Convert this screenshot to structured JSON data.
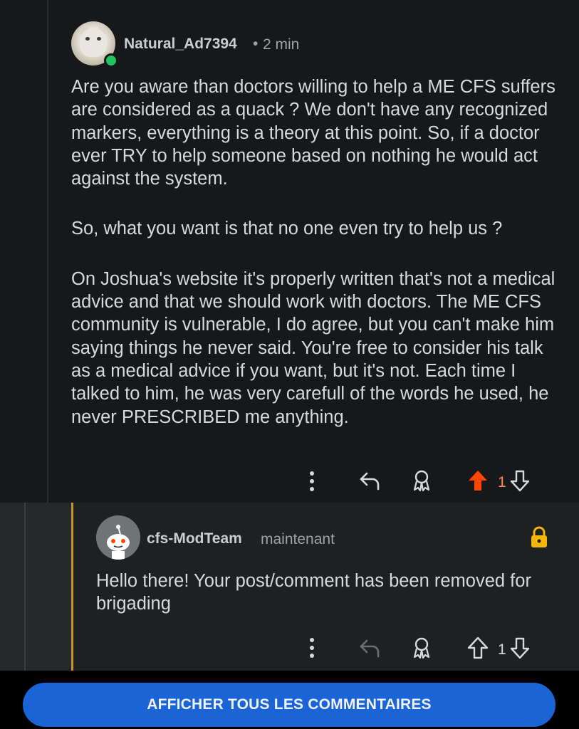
{
  "comment1": {
    "author": "Natural_Ad7394",
    "separator": "•",
    "time": "2 min",
    "paragraphs": [
      "Are you aware than doctors willing to help a ME CFS suffers are considered as a quack ? We don't have any recognized markers, everything is a theory at this point. So, if a doctor ever TRY to help someone based on nothing he would act against the system.",
      "So, what you want is that no one even try to help us ?",
      "On Joshua's website it's properly written that's not a medical advice and that we should work with doctors. The ME CFS community is vulnerable, I do agree, but you can't make him saying things he never said. You're free to consider his talk as a medical advice if you want, but it's not. Each time I talked to him, he was very carefull of the words he used, he never PRESCRIBED me anything."
    ],
    "votes": "1",
    "upvote_color": "#ff4500",
    "online_color": "#21c55d"
  },
  "comment2": {
    "author": "cfs-ModTeam",
    "time": "maintenant",
    "text": "Hello there! Your post/comment has been removed for brigading",
    "votes": "1",
    "lock_color": "#f5b50a",
    "stripe_color": "#c8941a"
  },
  "footer": {
    "button_label": "AFFICHER TOUS LES COMMENTAIRES",
    "button_color": "#1a64d6"
  },
  "icons": [
    "more-icon",
    "reply-icon",
    "award-icon",
    "upvote-icon",
    "downvote-icon",
    "lock-icon",
    "online-indicator-icon"
  ]
}
